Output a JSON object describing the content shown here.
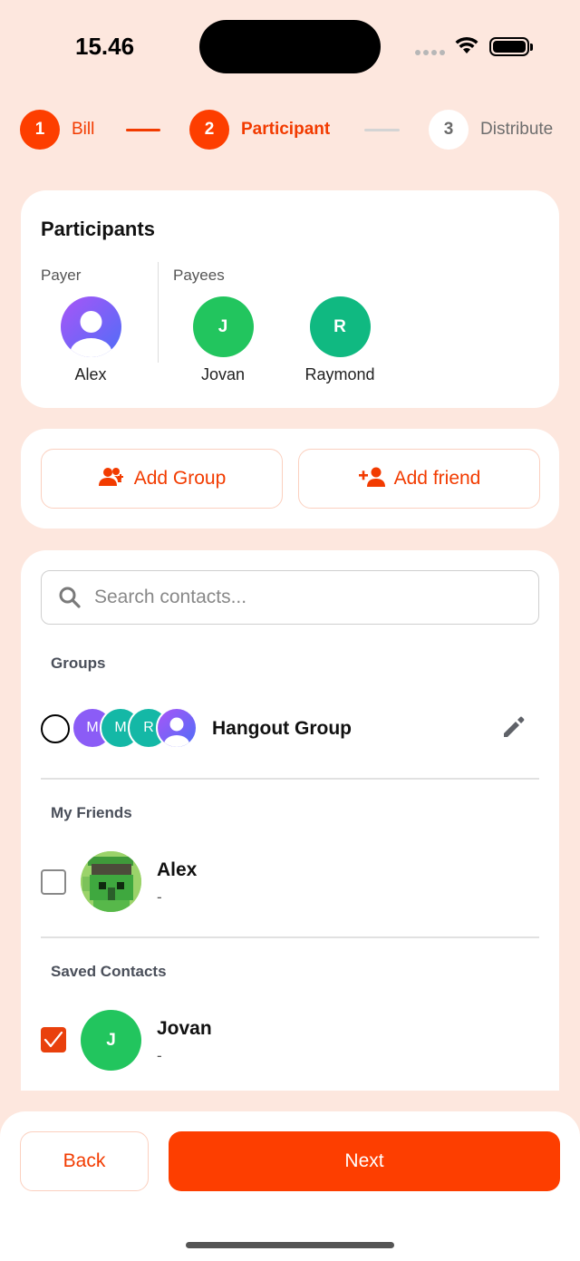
{
  "status": {
    "time": "15.46"
  },
  "stepper": {
    "steps": [
      {
        "number": "1",
        "label": "Bill",
        "state": "active"
      },
      {
        "number": "2",
        "label": "Participant",
        "state": "active"
      },
      {
        "number": "3",
        "label": "Distribute",
        "state": "pending"
      }
    ]
  },
  "participants": {
    "title": "Participants",
    "payer_label": "Payer",
    "payees_label": "Payees",
    "payer": {
      "name": "Alex",
      "avatar": "user-icon"
    },
    "payees": [
      {
        "initial": "J",
        "name": "Jovan",
        "color": "#22c55e"
      },
      {
        "initial": "R",
        "name": "Raymond",
        "color": "#10b981"
      }
    ]
  },
  "actions": {
    "add_group": "Add Group",
    "add_friend": "Add friend"
  },
  "contacts": {
    "search_placeholder": "Search contacts...",
    "groups_label": "Groups",
    "groups": [
      {
        "name": "Hangout Group",
        "member_initials": [
          "M",
          "M",
          "R"
        ],
        "selected": false
      }
    ],
    "friends_label": "My Friends",
    "friends": [
      {
        "name": "Alex",
        "sub": "-",
        "checked": false
      }
    ],
    "saved_label": "Saved Contacts",
    "saved": [
      {
        "initial": "J",
        "name": "Jovan",
        "sub": "-",
        "checked": true
      }
    ]
  },
  "footer": {
    "back": "Back",
    "next": "Next"
  },
  "colors": {
    "accent": "#fd3e00",
    "background": "#fde7de"
  }
}
